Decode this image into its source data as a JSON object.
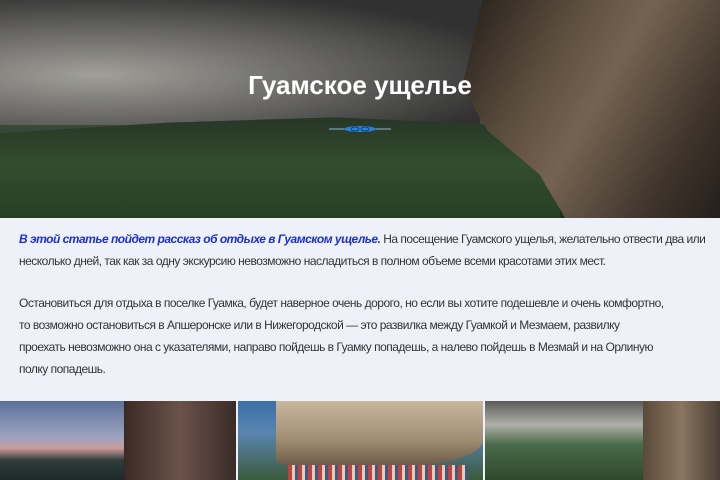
{
  "hero": {
    "title": "Гуамское ущелье"
  },
  "article": {
    "lead": "В этой статье пойдет рассказ об отдыхе в Гуамском ущелье.",
    "p1_rest_line1": " На посещение Гуамского ущелья, желательно отвести два или",
    "p1_line2": "несколько дней, так как за одну экскурсию невозможно насладиться в полном объеме всеми красотами этих мест.",
    "p2_lines": [
      "Остановиться для отдыха в поселке Гуамка, будет наверное очень дорого, но если вы хотите подешевле и очень комфортно,",
      "то возможно остановиться в Апшеронске или в Нижегородской — это развилка между Гуамкой и Мезмаем, развилку",
      "проехать невозможно она с указателями, направо пойдешь в Гуамку попадешь, а налево пойдешь в Мезмай и на Орлиную",
      "полку попадешь."
    ]
  },
  "colors": {
    "lead": "#1a2fd6",
    "background": "#eef2f8",
    "divider": "#2a7fd0"
  }
}
